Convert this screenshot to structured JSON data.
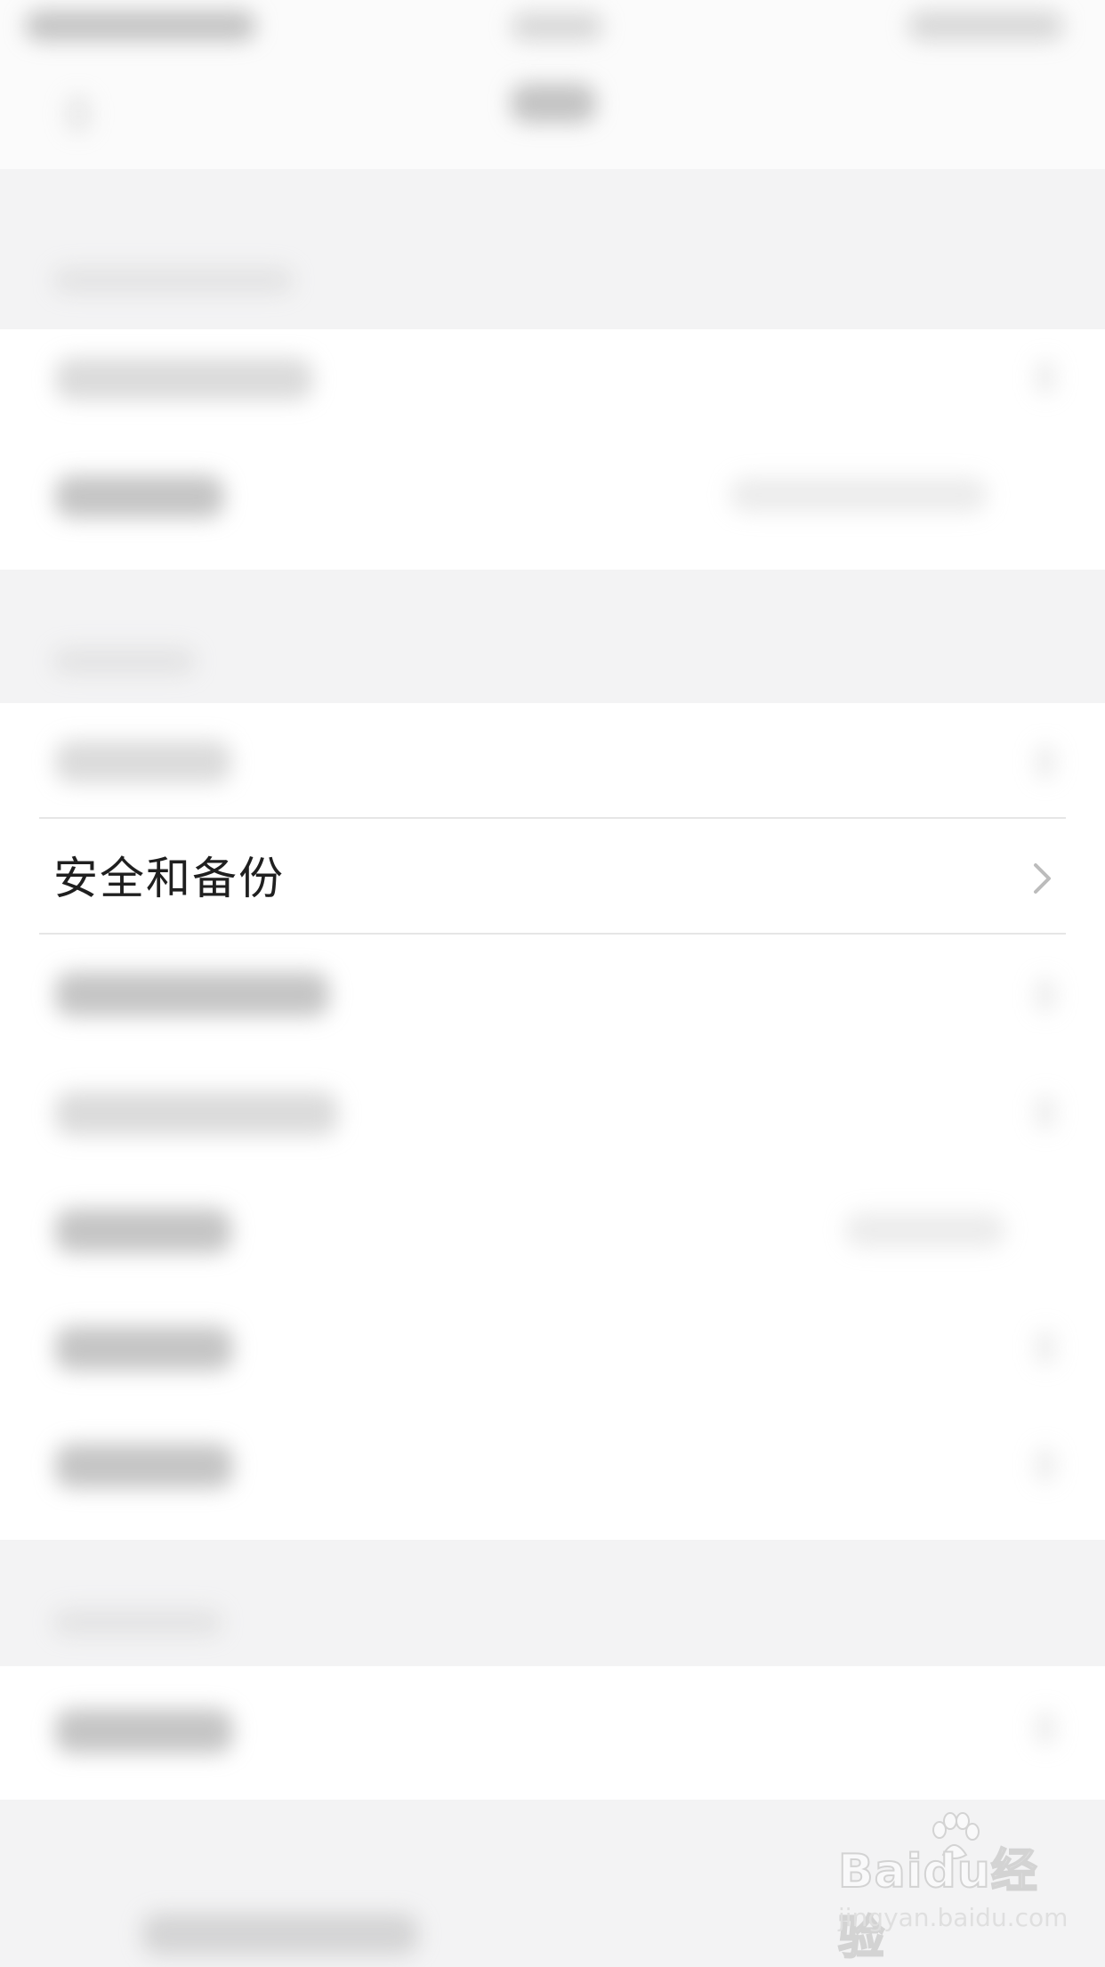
{
  "settings_list": {
    "focused_item": {
      "label": "安全和备份",
      "chevron_icon": "chevron-right-icon"
    }
  },
  "watermark": {
    "brand": "Baidu经验",
    "url": "jingyan.baidu.com"
  }
}
